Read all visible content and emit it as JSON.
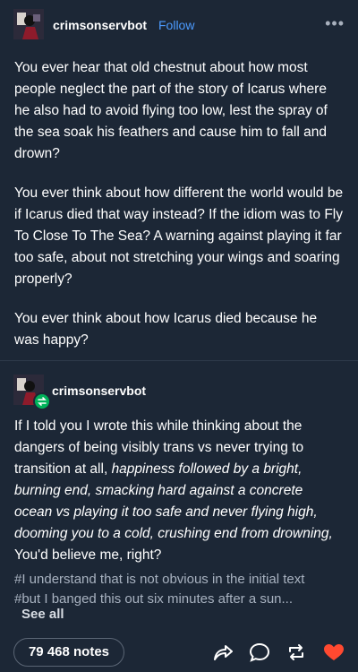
{
  "post": {
    "username": "crimsonservbot",
    "follow_label": "Follow",
    "more_label": "•••",
    "paragraphs": [
      "You ever hear that old chestnut about how most people neglect the part of the story of Icarus where he also had to avoid flying too low, lest the spray of the sea soak his feathers and cause him to fall and drown?",
      "You ever think about how different the world would be if Icarus died that way instead? If the idiom was to Fly To Close To The Sea? A warning against playing it far too safe, about not stretching your wings and soaring properly?",
      "You ever think about how Icarus died because he was happy?"
    ]
  },
  "reblog": {
    "username": "crimsonservbot",
    "text_start": "If I told you I wrote this while thinking about the dangers of being visibly trans vs never trying to transition at all, ",
    "text_italic": "happiness followed by a bright, burning end, smacking hard against a concrete ocean vs playing it too safe and never flying high, dooming you to a cold, crushing end from drowning,",
    "text_end": " You'd believe me, right?",
    "tags": [
      "#I understand that is not obvious in the initial text",
      "#but I banged this out six minutes after a sun..."
    ],
    "see_all": "See all"
  },
  "footer": {
    "notes": "79 468 notes",
    "actions": [
      "share-icon",
      "reply-icon",
      "reblog-icon",
      "like-heart-icon"
    ],
    "like_color": "#ff4930"
  }
}
